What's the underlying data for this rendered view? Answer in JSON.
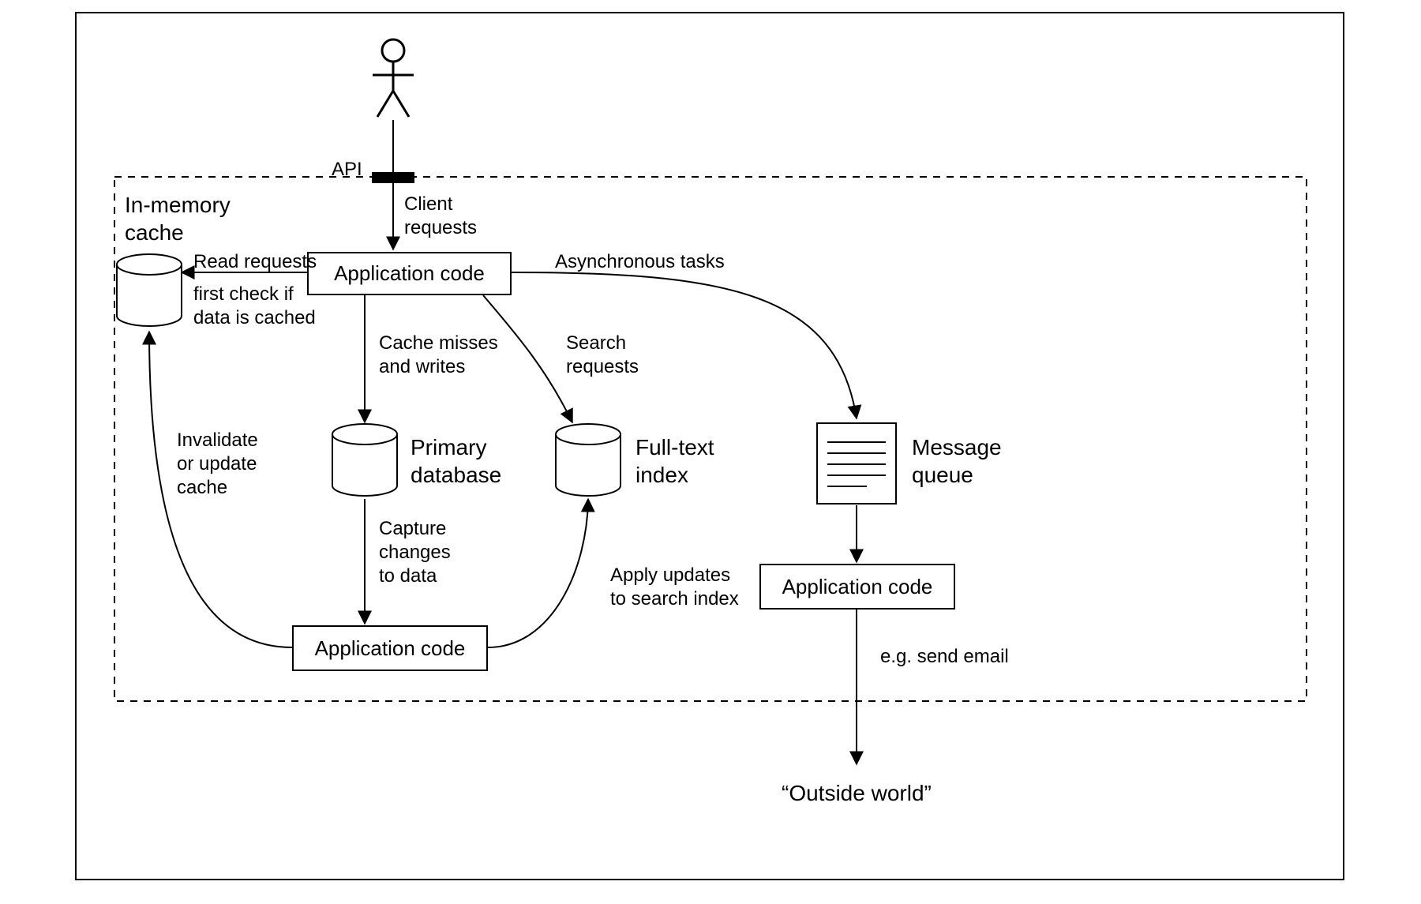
{
  "nodes": {
    "cache_title": "In-memory\ncache",
    "app_top": "Application code",
    "primary_db": "Primary\ndatabase",
    "fulltext": "Full-text\nindex",
    "msg_queue": "Message\nqueue",
    "app_bottom": "Application code",
    "app_right": "Application code",
    "outside": "“Outside world”"
  },
  "labels": {
    "api": "API",
    "client_requests": "Client\nrequests",
    "read_requests": "Read requests",
    "first_check": "first check if\ndata is cached",
    "async_tasks": "Asynchronous tasks",
    "cache_misses": "Cache misses\nand writes",
    "search_requests": "Search\nrequests",
    "capture_changes": "Capture\nchanges\nto data",
    "invalidate": "Invalidate\nor update\ncache",
    "apply_updates": "Apply updates\nto search index",
    "send_email": "e.g. send email"
  }
}
